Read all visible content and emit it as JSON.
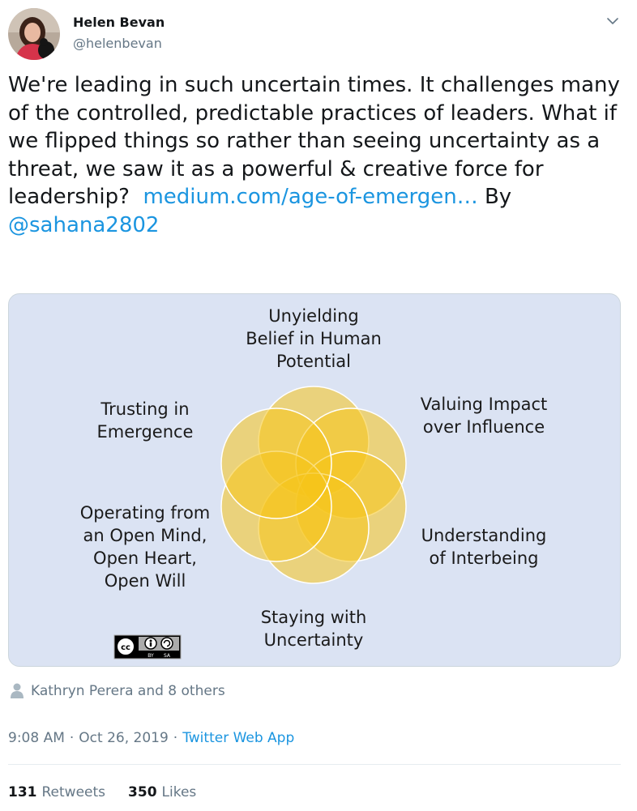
{
  "author": {
    "name": "Helen Bevan",
    "handle": "@helenbevan"
  },
  "tweet": {
    "text_main": "We're leading in such uncertain times. It challenges many of the controlled, predictable practices of leaders. What if we flipped things so rather than seeing uncertainty as a threat, we saw it as a powerful & creative force for leadership?",
    "link_text": "medium.com/age-of-emergen…",
    "by_text": "By",
    "mention": "@sahana2802"
  },
  "diagram": {
    "labels": {
      "top": [
        "Unyielding",
        "Belief in Human",
        "Potential"
      ],
      "top_left": [
        "Trusting in",
        "Emergence"
      ],
      "top_right": [
        "Valuing Impact",
        "over Influence"
      ],
      "bottom_left": [
        "Operating from",
        "an Open Mind,",
        "Open Heart,",
        "Open Will"
      ],
      "bottom_right": [
        "Understanding",
        "of Interbeing"
      ],
      "bottom": [
        "Staying with",
        "Uncertainty"
      ]
    },
    "license_badge": [
      "BY",
      "SA"
    ],
    "colors": {
      "background": "#dbe3f3",
      "petal": "#f6c51a",
      "petal_stroke": "#ffffff"
    }
  },
  "likers": {
    "text": "Kathryn Perera and 8 others"
  },
  "meta": {
    "time": "9:08 AM",
    "separator": "·",
    "date": "Oct 26, 2019",
    "separator2": "·",
    "source": "Twitter Web App"
  },
  "stats": {
    "retweets_count": "131",
    "retweets_label": "Retweets",
    "likes_count": "350",
    "likes_label": "Likes"
  },
  "colors": {
    "link": "#1b95e0",
    "muted": "#657786",
    "text": "#14171a"
  }
}
